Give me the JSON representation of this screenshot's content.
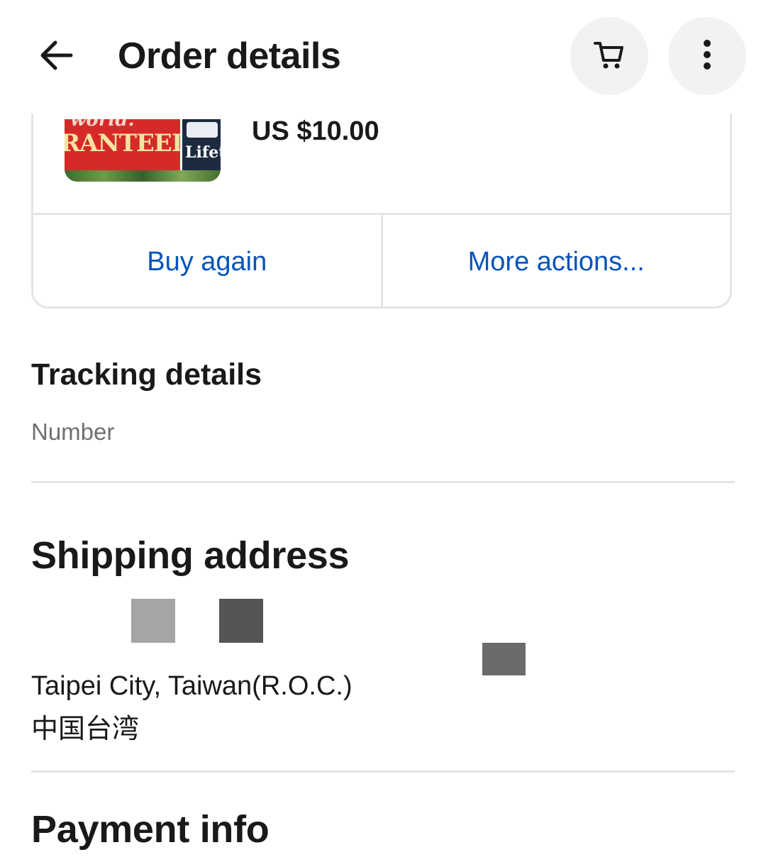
{
  "header": {
    "title": "Order details",
    "back_icon": "arrow-left-icon",
    "cart_icon": "cart-icon",
    "more_icon": "more-vertical-icon"
  },
  "item": {
    "price": "US $10.00",
    "thumbnail_text_top": "world.",
    "thumbnail_text_main": "RANTEED.",
    "thumbnail_text_badge": "Lifet"
  },
  "actions": {
    "buy_again": "Buy again",
    "more_actions": "More actions..."
  },
  "tracking": {
    "title": "Tracking details",
    "number_label": "Number"
  },
  "shipping": {
    "title": "Shipping address",
    "city_line": "Taipei City, Taiwan(R.O.C.)",
    "region_line": "中国台湾"
  },
  "payment": {
    "title": "Payment info"
  },
  "colors": {
    "link": "#0654ba",
    "text": "#191919",
    "muted": "#707070",
    "divider": "#e5e5e5",
    "icon_bg": "#f2f2f2"
  }
}
